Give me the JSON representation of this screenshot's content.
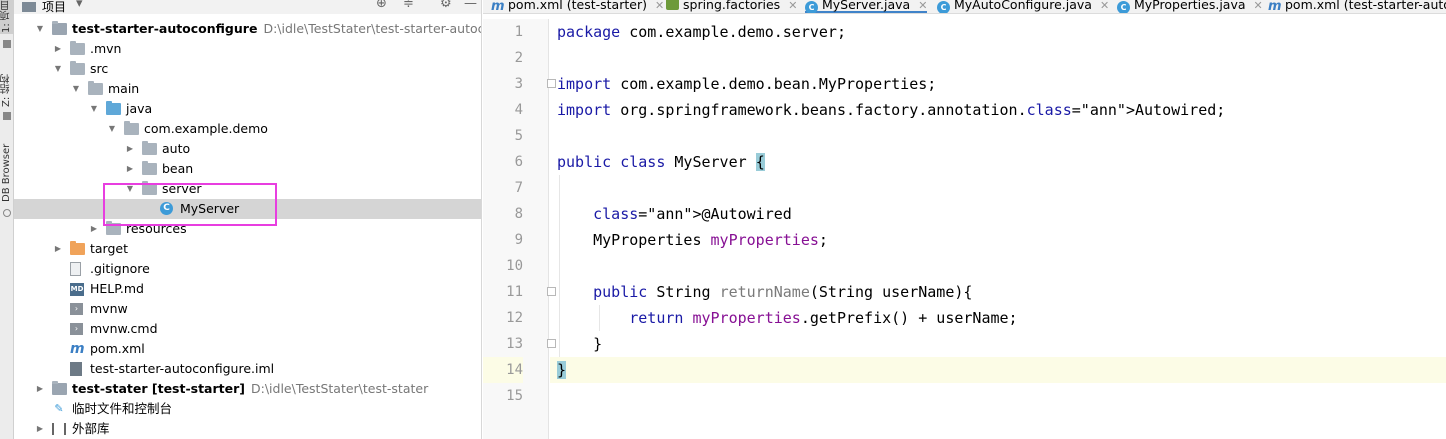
{
  "toolstrip": {
    "project_label": "1: 项目",
    "structure_label": "Z: 结构",
    "db_label": "DB Browser"
  },
  "project_panel": {
    "title": "项目",
    "tree": [
      {
        "label": "test-starter-autoconfigure",
        "path": "D:\\idle\\TestStater\\test-starter-autoconfigure",
        "bold": true,
        "icon": "module-folder-icon",
        "depth": 0,
        "expanded": true
      },
      {
        "label": ".mvn",
        "icon": "folder-icon",
        "depth": 1,
        "expanded": false
      },
      {
        "label": "src",
        "icon": "folder-icon",
        "depth": 1,
        "expanded": true
      },
      {
        "label": "main",
        "icon": "folder-icon",
        "depth": 2,
        "expanded": true
      },
      {
        "label": "java",
        "icon": "source-folder-icon",
        "depth": 3,
        "expanded": true
      },
      {
        "label": "com.example.demo",
        "icon": "package-icon",
        "depth": 4,
        "expanded": true
      },
      {
        "label": "auto",
        "icon": "package-icon",
        "depth": 5,
        "expanded": false
      },
      {
        "label": "bean",
        "icon": "package-icon",
        "depth": 5,
        "expanded": false
      },
      {
        "label": "server",
        "icon": "package-icon",
        "depth": 5,
        "expanded": true
      },
      {
        "label": "MyServer",
        "icon": "java-class-icon",
        "depth": 6,
        "selected": true
      },
      {
        "label": "resources",
        "icon": "resources-folder-icon",
        "depth": 3,
        "expanded": false
      },
      {
        "label": "target",
        "icon": "excluded-folder-icon",
        "depth": 1,
        "expanded": false
      },
      {
        "label": ".gitignore",
        "icon": "text-file-icon",
        "depth": 1
      },
      {
        "label": "HELP.md",
        "icon": "markdown-file-icon",
        "depth": 1
      },
      {
        "label": "mvnw",
        "icon": "shell-file-icon",
        "depth": 1
      },
      {
        "label": "mvnw.cmd",
        "icon": "shell-file-icon",
        "depth": 1
      },
      {
        "label": "pom.xml",
        "icon": "maven-icon",
        "depth": 1
      },
      {
        "label": "test-starter-autoconfigure.iml",
        "icon": "iml-file-icon",
        "depth": 1
      },
      {
        "label": "test-stater [test-starter]",
        "path": "D:\\idle\\TestStater\\test-stater",
        "bold": true,
        "icon": "module-folder-icon",
        "depth": 0,
        "expanded": false
      },
      {
        "label": "临时文件和控制台",
        "icon": "scratches-icon",
        "depth": 0
      },
      {
        "label": "外部库",
        "icon": "library-icon",
        "depth": 0,
        "expanded": false
      }
    ]
  },
  "tabs": [
    {
      "label": "pom.xml (test-starter)",
      "icon": "maven-icon",
      "active": false
    },
    {
      "label": "spring.factories",
      "icon": "spring-file-icon",
      "active": false
    },
    {
      "label": "MyServer.java",
      "icon": "java-class-icon",
      "active": true
    },
    {
      "label": "MyAutoConfigure.java",
      "icon": "java-class-icon",
      "active": false
    },
    {
      "label": "MyProperties.java",
      "icon": "java-class-icon",
      "active": false
    },
    {
      "label": "pom.xml (test-starter-autoconfigure)",
      "icon": "maven-icon",
      "active": false
    }
  ],
  "editor": {
    "line_numbers": [
      "1",
      "2",
      "3",
      "4",
      "5",
      "6",
      "7",
      "8",
      "9",
      "10",
      "11",
      "12",
      "13",
      "14",
      "15"
    ],
    "lines": [
      "package com.example.demo.server;",
      "",
      "import com.example.demo.bean.MyProperties;",
      "import org.springframework.beans.factory.annotation.Autowired;",
      "",
      "public class MyServer {",
      "",
      "    @Autowired",
      "    MyProperties myProperties;",
      "",
      "    public String returnName(String userName){",
      "        return myProperties.getPrefix() + userName;",
      "    }",
      "}",
      ""
    ],
    "caret_line": 14
  }
}
